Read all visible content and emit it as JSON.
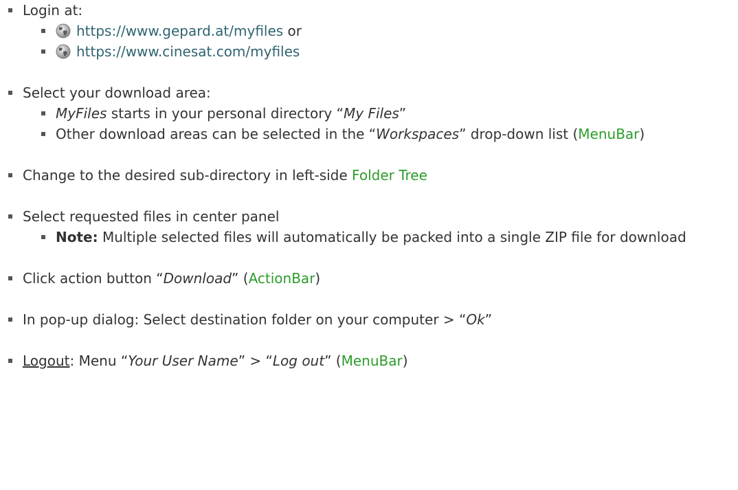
{
  "steps": [
    {
      "text": "Login at:",
      "links": [
        {
          "url": "https://www.gepard.at/myfiles",
          "suffix": " or",
          "icon": "globe-icon"
        },
        {
          "url": "https://www.cinesat.com/myfiles",
          "suffix": "",
          "icon": "globe-icon"
        }
      ]
    },
    {
      "text": "Select your download area:",
      "sub1_em": "MyFiles",
      "sub1_mid": " starts in your personal directory “",
      "sub1_em2": "My Files",
      "sub1_end": "”",
      "sub2_a": "Other download areas can be selected in the “",
      "sub2_em": "Workspaces",
      "sub2_b": "” drop-down list (",
      "sub2_link": "MenuBar",
      "sub2_end": ")"
    },
    {
      "text": "Change to the desired sub-directory in left-side ",
      "link": "Folder Tree"
    },
    {
      "text": "Select requested files in center panel",
      "note_label": "Note:",
      "note_text": " Multiple selected files will automatically be packed into a single ZIP file for download"
    },
    {
      "a": "Click action button “",
      "em": "Download",
      "b": "” (",
      "link": "ActionBar",
      "end": ")"
    },
    {
      "a": "In pop-up dialog: Select destination folder on your computer > “",
      "em": "Ok",
      "end": "”"
    },
    {
      "u": "Logout",
      "a": ": Menu “",
      "em1": "Your User Name",
      "b": "” > “",
      "em2": "Log out",
      "c": "” (",
      "link": "MenuBar",
      "end": ")"
    }
  ],
  "colors": {
    "external_link": "#2f6470",
    "internal_link": "#2b9c2b",
    "text": "#333333"
  }
}
